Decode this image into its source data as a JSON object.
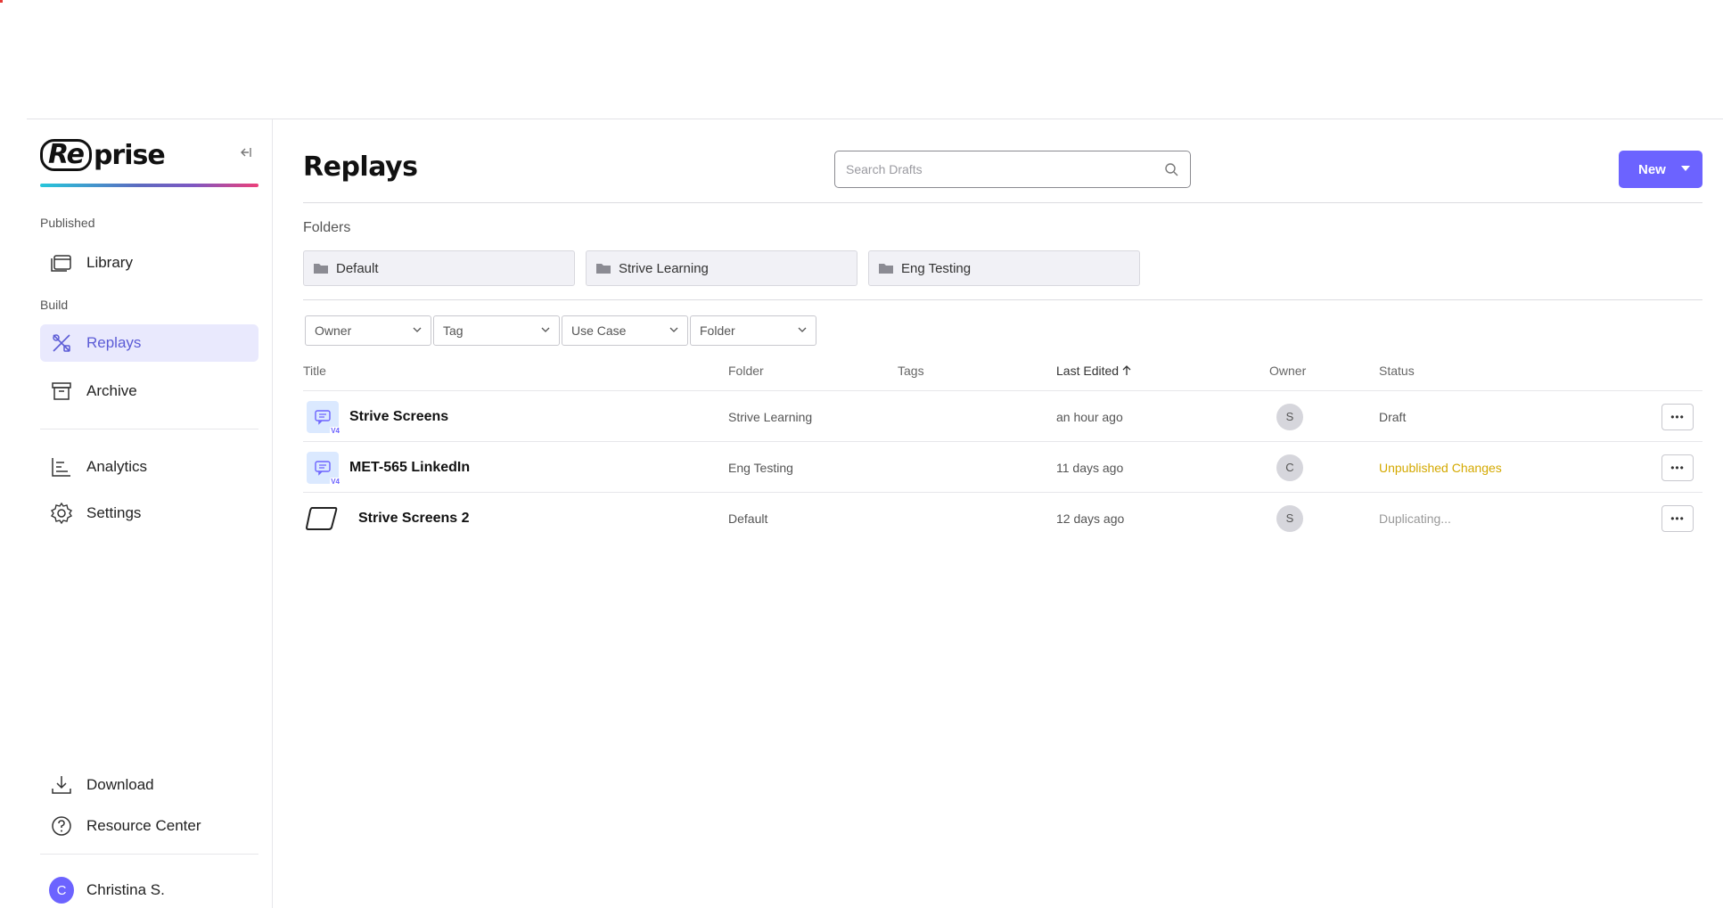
{
  "sidebar": {
    "logo": {
      "part1": "Re",
      "part2": "prise"
    },
    "collapse_icon": "collapse-left-icon",
    "sections": {
      "published": "Published",
      "build": "Build"
    },
    "items": {
      "library": {
        "label": "Library",
        "icon": "library-icon"
      },
      "replays": {
        "label": "Replays",
        "icon": "replays-icon"
      },
      "archive": {
        "label": "Archive",
        "icon": "archive-icon"
      },
      "analytics": {
        "label": "Analytics",
        "icon": "analytics-icon"
      },
      "settings": {
        "label": "Settings",
        "icon": "gear-icon"
      },
      "download": {
        "label": "Download",
        "icon": "download-icon"
      },
      "resource_center": {
        "label": "Resource Center",
        "icon": "help-icon"
      }
    },
    "user": {
      "initial": "C",
      "name": "Christina S."
    }
  },
  "main": {
    "title": "Replays",
    "search": {
      "placeholder": "Search Drafts",
      "value": ""
    },
    "new_button": "New",
    "folders_label": "Folders",
    "folders": [
      "Default",
      "Strive Learning",
      "Eng Testing"
    ],
    "filters": [
      "Owner",
      "Tag",
      "Use Case",
      "Folder"
    ],
    "columns": {
      "title": "Title",
      "folder": "Folder",
      "tags": "Tags",
      "last_edited": "Last Edited",
      "owner": "Owner",
      "status": "Status"
    },
    "rows": [
      {
        "title": "Strive Screens",
        "folder": "Strive Learning",
        "tags": "",
        "last_edited": "an hour ago",
        "owner": "S",
        "status": "Draft",
        "badge": "V4"
      },
      {
        "title": "MET-565 LinkedIn",
        "folder": "Eng Testing",
        "tags": "",
        "last_edited": "11 days ago",
        "owner": "C",
        "status": "Unpublished Changes",
        "badge": "V4"
      },
      {
        "title": "Strive Screens 2",
        "folder": "Default",
        "tags": "",
        "last_edited": "12 days ago",
        "owner": "S",
        "status": "Duplicating..."
      }
    ]
  },
  "colors": {
    "accent": "#6c63ff",
    "active_bg": "#e9e9fd",
    "status_unpublished": "#d4a900",
    "status_muted": "#999999"
  }
}
